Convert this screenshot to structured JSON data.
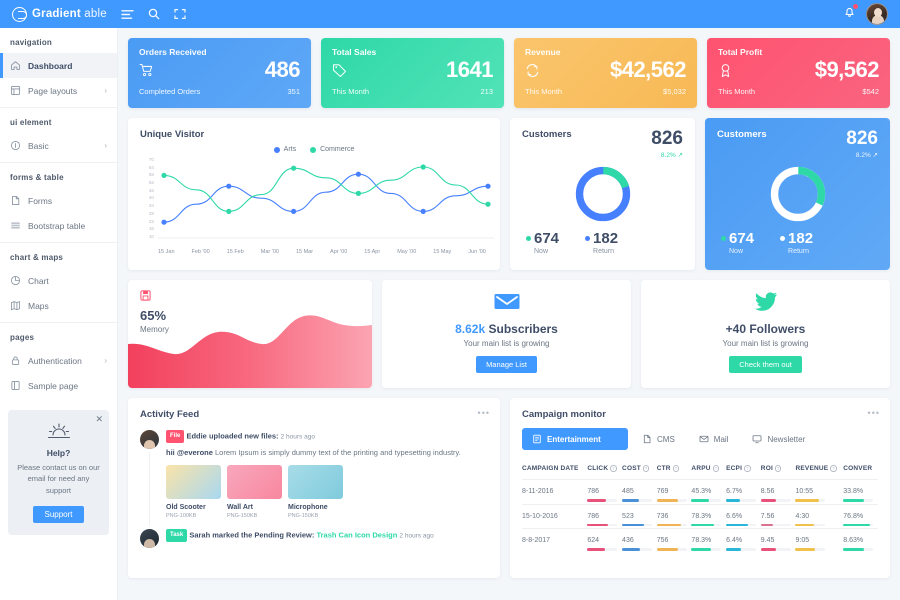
{
  "topbar": {
    "brand_bold": "Gradient",
    "brand_thin": "able",
    "menu_icon": "menu-icon",
    "search_icon": "search-icon",
    "fullscreen_icon": "fullscreen-icon",
    "bell_icon": "bell-icon",
    "avatar": "user-avatar",
    "bg": "#4099ff"
  },
  "sidebar": {
    "sections": [
      {
        "label": "navigation",
        "items": [
          {
            "label": "Dashboard",
            "icon": "home-icon",
            "active": true,
            "chevron": false
          },
          {
            "label": "Page layouts",
            "icon": "layout-icon",
            "active": false,
            "chevron": true
          }
        ]
      },
      {
        "label": "ui element",
        "items": [
          {
            "label": "Basic",
            "icon": "circle-icon",
            "active": false,
            "chevron": true
          }
        ]
      },
      {
        "label": "forms & table",
        "items": [
          {
            "label": "Forms",
            "icon": "file-icon",
            "active": false,
            "chevron": false
          },
          {
            "label": "Bootstrap table",
            "icon": "table-icon",
            "active": false,
            "chevron": false
          }
        ]
      },
      {
        "label": "chart & maps",
        "items": [
          {
            "label": "Chart",
            "icon": "pie-chart-icon",
            "active": false,
            "chevron": false
          },
          {
            "label": "Maps",
            "icon": "map-icon",
            "active": false,
            "chevron": false
          }
        ]
      },
      {
        "label": "pages",
        "items": [
          {
            "label": "Authentication",
            "icon": "lock-icon",
            "active": false,
            "chevron": true
          },
          {
            "label": "Sample page",
            "icon": "page-icon",
            "active": false,
            "chevron": false
          }
        ]
      }
    ],
    "help": {
      "close_icon": "close-icon",
      "icon": "sunrise-icon",
      "title": "Help?",
      "text": "Please contact us on our email for need any support",
      "button": "Support",
      "button_color": "#4099ff"
    }
  },
  "stats": [
    {
      "title": "Orders Received",
      "icon": "cart-icon",
      "value": "486",
      "foot_label": "Completed Orders",
      "foot_value": "351",
      "color": "#4a9bf4"
    },
    {
      "title": "Total Sales",
      "icon": "tag-icon",
      "value": "1641",
      "foot_label": "This Month",
      "foot_value": "213",
      "color": "#2ed8a7"
    },
    {
      "title": "Revenue",
      "icon": "refresh-icon",
      "value": "$42,562",
      "foot_label": "This Month",
      "foot_value": "$5,032",
      "color": "#f7b955"
    },
    {
      "title": "Total Profit",
      "icon": "award-icon",
      "value": "$9,562",
      "foot_label": "This Month",
      "foot_value": "$542",
      "color": "#ff5370"
    }
  ],
  "chart_data": {
    "type": "line",
    "title": "Unique Visitor",
    "xlabel": "",
    "ylabel": "",
    "ylim": [
      10,
      70
    ],
    "yticks": [
      70,
      64,
      58,
      52,
      46,
      40,
      34,
      28,
      22,
      16,
      10
    ],
    "x": [
      "15 Jan",
      "Feb '00",
      "15 Feb",
      "Mar '00",
      "15 Mar",
      "Apr '00",
      "15 Apr",
      "May '00",
      "15 May",
      "Jun '00"
    ],
    "grid": false,
    "legend_position": "top-center",
    "series": [
      {
        "name": "Arts",
        "color": "#4680ff",
        "values": [
          19,
          34,
          49,
          39,
          28,
          44,
          59,
          43,
          28,
          41,
          49
        ]
      },
      {
        "name": "Commerce",
        "color": "#2ed8a7",
        "values": [
          58,
          46,
          28,
          42,
          64,
          56,
          43,
          54,
          65,
          50,
          34
        ]
      }
    ]
  },
  "customers": [
    {
      "title": "Customers",
      "value": "826",
      "pct": "8.2%",
      "trend_icon": "trend-up-icon",
      "donut": {
        "now_pct": 80,
        "return_pct": 20,
        "now_color": "#4680ff",
        "return_color": "#2ed8a7"
      },
      "now_value": "674",
      "now_label": "Now",
      "return_value": "182",
      "return_label": "Return",
      "theme": "light"
    },
    {
      "title": "Customers",
      "value": "826",
      "pct": "8.2%",
      "trend_icon": "trend-up-icon",
      "donut": {
        "now_pct": 68,
        "return_pct": 32,
        "now_color": "#ffffff",
        "return_color": "#2ed8a7"
      },
      "now_value": "674",
      "now_label": "Now",
      "return_value": "182",
      "return_label": "Return",
      "theme": "blue"
    }
  ],
  "memory": {
    "icon": "save-icon",
    "value": "65%",
    "label": "Memory",
    "color": "#ff5370"
  },
  "promos": [
    {
      "icon": "envelope-icon",
      "icon_color": "#4099ff",
      "highlight": "8.62k",
      "title": " Subscribers",
      "sub": "Your main list is growing",
      "button": "Manage List",
      "button_color": "#4099ff"
    },
    {
      "icon": "twitter-icon",
      "icon_color": "#2ed8a7",
      "highlight": "+40",
      "title": " Followers",
      "sub": "Your main list is growing",
      "button": "Check them out",
      "button_color": "#2ed8a7"
    }
  ],
  "activity_feed": {
    "title": "Activity Feed",
    "menu_icon": "more-icon",
    "items": [
      {
        "badge": "File",
        "badge_color": "#ff5370",
        "headline": "Eddie uploaded new files:",
        "time": "2 hours ago",
        "body_mention": "hii @everone",
        "body_rest": " Lorem Ipsum is simply dummy text of the printing and typesetting industry.",
        "thumbs": [
          {
            "name": "Old Scooter",
            "meta": "PNG-100KB",
            "c1": "#fbe3a8",
            "c2": "#a8d8f0"
          },
          {
            "name": "Wall Art",
            "meta": "PNG-150KB",
            "c1": "#f9a8bd",
            "c2": "#f7879f"
          },
          {
            "name": "Microphone",
            "meta": "PNG-150KB",
            "c1": "#a8dce8",
            "c2": "#7fcbdd"
          }
        ]
      },
      {
        "badge": "Task",
        "badge_color": "#2ed8a7",
        "headline": "Sarah marked the Pending Review:",
        "link": "Trash Can Icon Design",
        "time": "2 hours ago"
      }
    ]
  },
  "campaign": {
    "title": "Campaign monitor",
    "menu_icon": "more-icon",
    "tabs": [
      {
        "label": "Entertainment",
        "icon": "entertainment-icon",
        "active": true
      },
      {
        "label": "CMS",
        "icon": "cms-icon",
        "active": false
      },
      {
        "label": "Mail",
        "icon": "mail-icon",
        "active": false
      },
      {
        "label": "Newsletter",
        "icon": "newsletter-icon",
        "active": false
      }
    ],
    "columns": [
      "CAMPAIGN DATE",
      "CLICK",
      "COST",
      "CTR",
      "ARPU",
      "ECPI",
      "ROI",
      "REVENUE",
      "CONVER"
    ],
    "column_help": [
      false,
      true,
      true,
      true,
      true,
      true,
      true,
      true,
      false
    ],
    "rows": [
      {
        "date": "8-11-2016",
        "cells": [
          {
            "v": "786",
            "pct": 62,
            "color": "#e8527a"
          },
          {
            "v": "485",
            "pct": 55,
            "color": "#4a90d9"
          },
          {
            "v": "769",
            "pct": 70,
            "color": "#f0b455"
          },
          {
            "v": "45.3%",
            "pct": 60,
            "color": "#2ed8a7"
          },
          {
            "v": "6.7%",
            "pct": 45,
            "color": "#29b6d8"
          },
          {
            "v": "8.56",
            "pct": 52,
            "color": "#e8527a"
          },
          {
            "v": "10:55",
            "pct": 78,
            "color": "#f0c14b"
          },
          {
            "v": "33.8%",
            "pct": 68,
            "color": "#2ed8a7"
          }
        ]
      },
      {
        "date": "15-10-2016",
        "cells": [
          {
            "v": "786",
            "pct": 70,
            "color": "#e8527a"
          },
          {
            "v": "523",
            "pct": 72,
            "color": "#4a90d9"
          },
          {
            "v": "736",
            "pct": 80,
            "color": "#f0b455"
          },
          {
            "v": "78.3%",
            "pct": 75,
            "color": "#2ed8a7"
          },
          {
            "v": "6.6%",
            "pct": 72,
            "color": "#29b6d8"
          },
          {
            "v": "7.56",
            "pct": 40,
            "color": "#d9738f"
          },
          {
            "v": "4:30",
            "pct": 62,
            "color": "#f0c14b"
          },
          {
            "v": "76.8%",
            "pct": 90,
            "color": "#2ed8a7"
          }
        ]
      },
      {
        "date": "8-8-2017",
        "cells": [
          {
            "v": "624",
            "pct": 58,
            "color": "#e8527a"
          },
          {
            "v": "436",
            "pct": 60,
            "color": "#4a90d9"
          },
          {
            "v": "756",
            "pct": 72,
            "color": "#f0b455"
          },
          {
            "v": "78.3%",
            "pct": 64,
            "color": "#2ed8a7"
          },
          {
            "v": "6.4%",
            "pct": 48,
            "color": "#29b6d8"
          },
          {
            "v": "9.45",
            "pct": 50,
            "color": "#e8527a"
          },
          {
            "v": "9:05",
            "pct": 66,
            "color": "#f0c14b"
          },
          {
            "v": "8.63%",
            "pct": 70,
            "color": "#2ed8a7"
          }
        ]
      }
    ]
  }
}
